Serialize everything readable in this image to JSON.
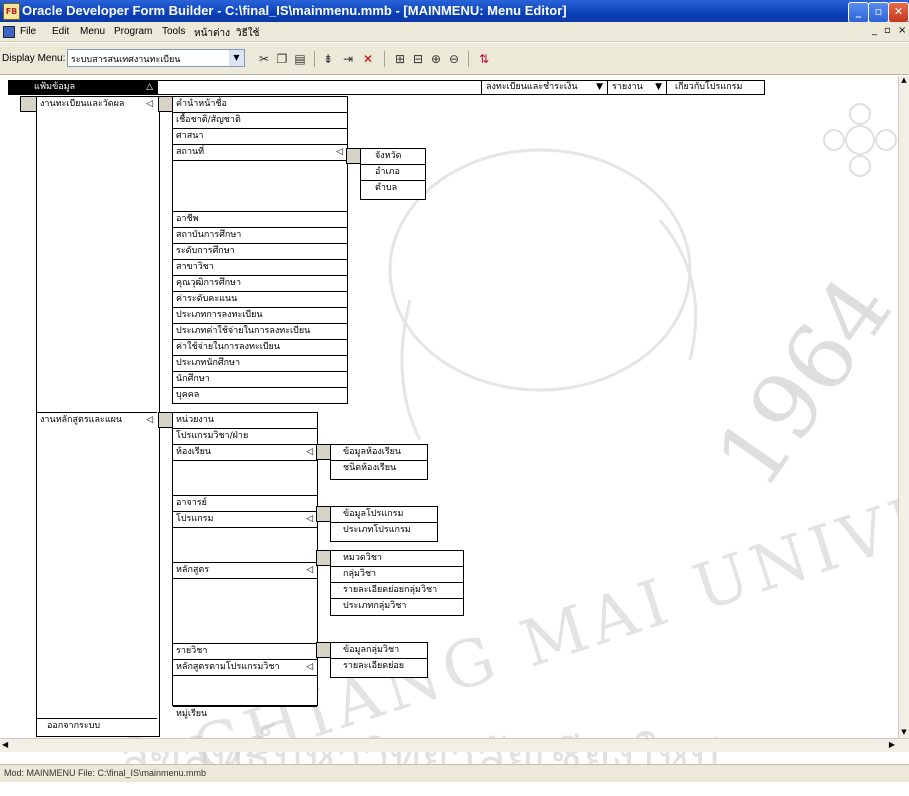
{
  "window": {
    "title": "Oracle Developer Form Builder - C:\\final_IS\\mainmenu.mmb - [MAINMENU: Menu Editor]",
    "app_icon_label": "FB"
  },
  "menubar": [
    "File",
    "Edit",
    "Menu",
    "Program",
    "Tools",
    "หน้าต่าง",
    "วิธีใช้"
  ],
  "toolbar": {
    "display_menu_label": "Display Menu:",
    "display_menu_value": "ระบบสารสนเทศงานทะเบียน"
  },
  "top_menu": {
    "items": [
      "แฟ้มข้อมูล",
      "ลงทะเบียนและชำระเงิน",
      "รายงาน",
      "เกี่ยวกับโปรแกรม"
    ]
  },
  "level1": {
    "items": [
      "งานทะเบียนและวัดผล",
      "งานหลักสูตรและแผน",
      "ออกจากระบบ"
    ]
  },
  "registration_menu": {
    "items": [
      "คำนำหน้าชื่อ",
      "เชื้อชาติ/สัญชาติ",
      "ศาสนา",
      "สถานที่",
      "",
      "",
      "อาชีพ",
      "สถาบันการศึกษา",
      "ระดับการศึกษา",
      "สาขาวิชา",
      "คุณวุฒิการศึกษา",
      "ค่าระดับคะแนน",
      "ประเภทการลงทะเบียน",
      "ประเภทค่าใช้จ่ายในการลงทะเบียน",
      "ค่าใช้จ่ายในการลงทะเบียน",
      "ประเภทนักศึกษา",
      "นักศึกษา",
      "บุคคล"
    ]
  },
  "place_menu": {
    "items": [
      "จังหวัด",
      "อำเภอ",
      "ตำบล"
    ]
  },
  "curriculum_menu": {
    "items": [
      "หน่วยงาน",
      "โปรแกรมวิชา/ฝ่าย",
      "ห้องเรียน",
      "",
      "อาจารย์",
      "โปรแกรม",
      "",
      "หลักสูตร",
      "",
      "",
      "",
      "",
      "รายวิชา",
      "หลักสูตรตามโปรแกรมวิชา",
      "",
      "หมู่เรียน"
    ]
  },
  "room_menu": {
    "items": [
      "ข้อมูลห้องเรียน",
      "ชนิดห้องเรียน"
    ]
  },
  "program_menu": {
    "items": [
      "ข้อมูลโปรแกรม",
      "ประเภทโปรแกรม"
    ]
  },
  "course_menu": {
    "items": [
      "หมวดวิชา",
      "กลุ่มวิชา",
      "รายละเอียดย่อยกลุ่มวิชา",
      "ประเภทกลุ่มวิชา"
    ]
  },
  "course_program_menu": {
    "items": [
      "ข้อมูลกลุ่มวิชา",
      "รายละเอียดย่อย"
    ]
  },
  "watermark": {
    "year": "1964",
    "bottom": "ลิขสิทธิ์มหาวิทยาลัยเชียงใหม่",
    "arc": "CHIANG MAI UNIVERSITY"
  },
  "status": {
    "text": "Mod: MAINMENU File: C:\\final_IS\\mainmenu.mmb"
  }
}
